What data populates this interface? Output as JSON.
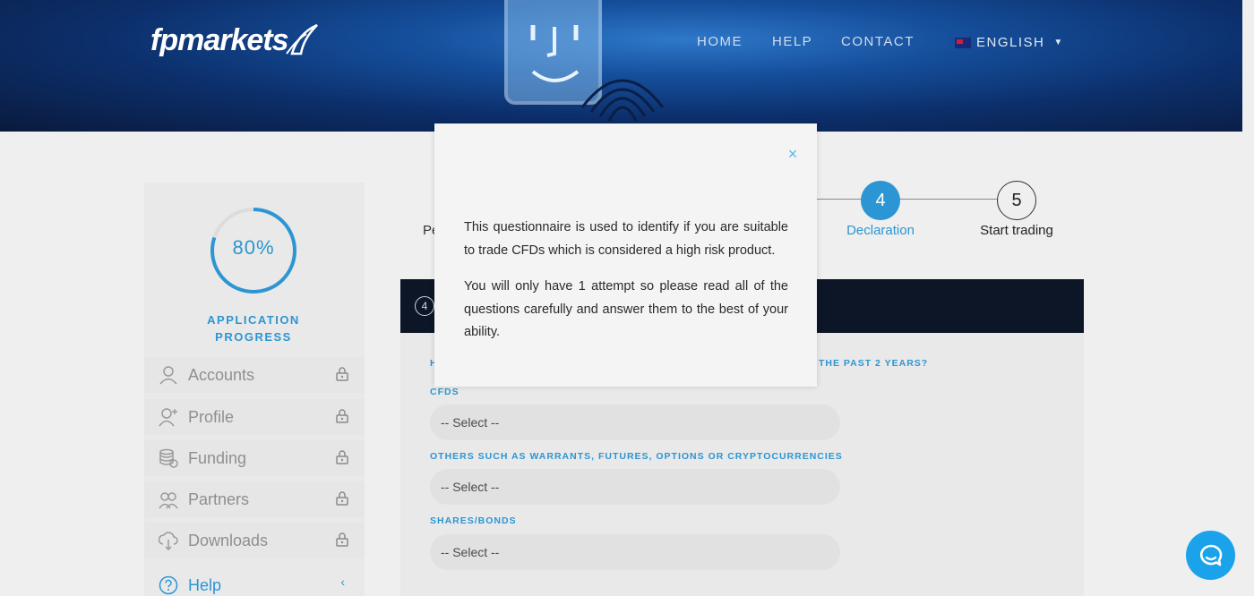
{
  "header": {
    "logo_text": "fpmarkets",
    "nav": [
      {
        "label": "HOME"
      },
      {
        "label": "HELP"
      },
      {
        "label": "CONTACT"
      }
    ],
    "language": "ENGLISH"
  },
  "sidebar": {
    "progress_value": "80%",
    "progress_fraction": 0.8,
    "progress_label_line1": "APPLICATION",
    "progress_label_line2": "PROGRESS",
    "items": [
      {
        "label": "Accounts",
        "icon": "user-icon",
        "locked": true
      },
      {
        "label": "Profile",
        "icon": "user-plus-icon",
        "locked": true
      },
      {
        "label": "Funding",
        "icon": "coins-icon",
        "locked": true
      },
      {
        "label": "Partners",
        "icon": "partners-icon",
        "locked": true
      },
      {
        "label": "Downloads",
        "icon": "cloud-download-icon",
        "locked": true
      },
      {
        "label": "Help",
        "icon": "help-icon",
        "locked": false
      }
    ]
  },
  "steps": {
    "partial_label": "Pe",
    "step4_number": "4",
    "step4_label": "Declaration",
    "step5_number": "5",
    "step5_label": "Start trading"
  },
  "form": {
    "section_number": "4",
    "question_partial_left": "H",
    "question_partial_right": "THE PAST 2 YEARS?",
    "fields": [
      {
        "label": "CFDS",
        "value": "-- Select --"
      },
      {
        "label": "OTHERS SUCH AS WARRANTS, FUTURES, OPTIONS OR CRYPTOCURRENCIES",
        "value": "-- Select --"
      },
      {
        "label": "SHARES/BONDS",
        "value": "-- Select --"
      }
    ]
  },
  "modal": {
    "paragraph1": "This questionnaire is used to identify if you are suitable to trade CFDs which is considered a high risk product.",
    "paragraph2": "You will only have 1 attempt so please read all of the questions carefully and answer them to the best of your ability.",
    "close_symbol": "×"
  },
  "colors": {
    "accent": "#2b96d3",
    "header_dark": "#0a1a3d",
    "form_head": "#0c1626",
    "chat": "#1aa3ea"
  }
}
